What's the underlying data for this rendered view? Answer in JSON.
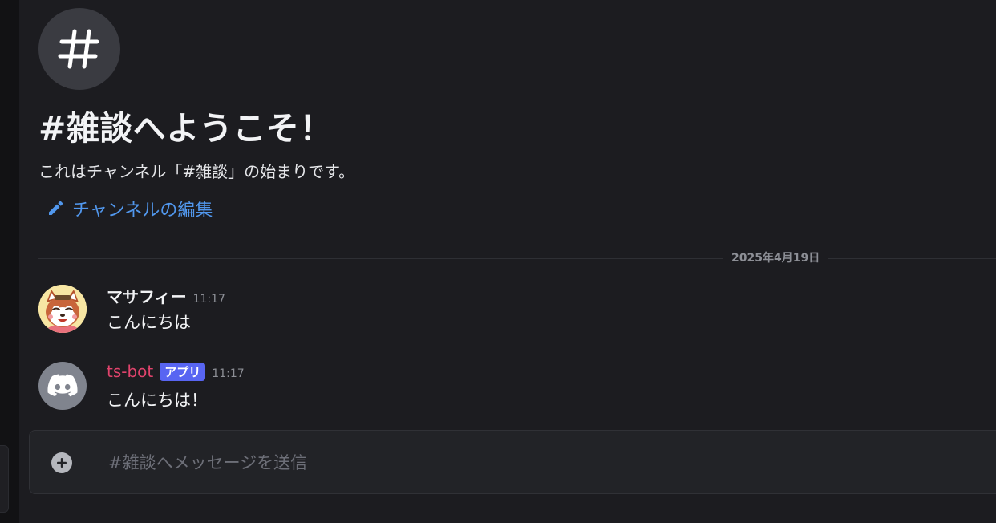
{
  "channel": {
    "icon": "hashtag-icon",
    "welcome_title": "#雑談へようこそ！",
    "welcome_description": "これはチャンネル「#雑談」の始まりです。",
    "edit_label": "チャンネルの編集"
  },
  "date_divider": "2025年4月19日",
  "messages": [
    {
      "author": "マサフィー",
      "time": "11:17",
      "text": "こんにちは",
      "avatar": "red-panda-avatar"
    },
    {
      "author": "ts-bot",
      "badge": "アプリ",
      "time": "11:17",
      "text": "こんにちは！",
      "avatar": "discord-logo-avatar"
    }
  ],
  "composer": {
    "placeholder": "#雑談へメッセージを送信"
  },
  "colors": {
    "background": "#1c1c20",
    "link": "#5197ed",
    "bot_name": "#e0436c",
    "app_badge": "#5865f2"
  }
}
